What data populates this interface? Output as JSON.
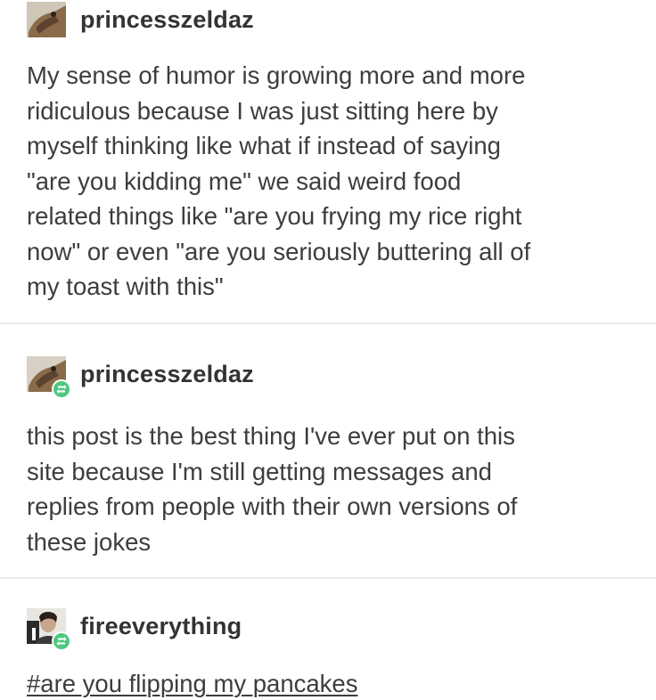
{
  "posts": [
    {
      "username": "princesszeldaz",
      "avatar_icon": "dog-avatar-icon",
      "reblog": false,
      "lines": [
        "My sense of humor is growing more and more",
        "ridiculous because I was just sitting here by",
        "myself thinking like what if instead of saying",
        "\"are you kidding me\" we said weird food",
        "related things like \"are you frying my rice right",
        "now\" or even \"are you seriously buttering all of",
        "my toast with this\""
      ]
    },
    {
      "username": "princesszeldaz",
      "avatar_icon": "dog-avatar-icon",
      "reblog": true,
      "lines": [
        "this post is the best thing I've ever put on this",
        "site because I'm still getting messages and",
        "replies from people with their own versions of",
        "these jokes"
      ]
    },
    {
      "username": "fireeverything",
      "avatar_icon": "person-avatar-icon",
      "reblog": true,
      "tag": "#are you flipping my pancakes"
    }
  ],
  "colors": {
    "text": "#3d3d3d",
    "reblog_badge": "#4ec87e",
    "divider": "#ececec"
  }
}
